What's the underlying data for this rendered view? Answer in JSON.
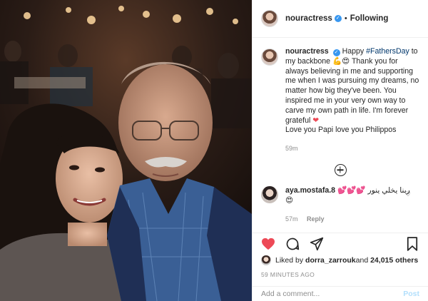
{
  "post": {
    "username": "nouractress",
    "dot": "•",
    "follow_label": "Following",
    "caption": {
      "username": "nouractress",
      "before_tag": "Happy ",
      "hashtag": "#FathersDay",
      "text_1": " to my backbone 💪😍 Thank you for always believing in me and supporting me when I was pursuing my dreams, no matter how big they've been. You inspired me in your very own way to carve my own path in life. I'm forever grateful ",
      "heart": "❤",
      "text_2": "Love you Papi love you Philippos",
      "time": "59m"
    },
    "comment": {
      "username": "aya.mostafa.8",
      "text": "ربنا يخلي ينور 💕💕💕 😍",
      "time": "57m",
      "reply_label": "Reply",
      "like_icon": "heart-outline-icon"
    },
    "likes": {
      "prefix": "Liked by ",
      "user": "dorra_zarrouk",
      "middle": " and ",
      "count": "24,015 others"
    },
    "timestamp": "59 MINUTES AGO",
    "add_comment_placeholder": "Add a comment...",
    "post_label": "Post"
  },
  "colors": {
    "heart": "#ed4956",
    "link": "#00376b",
    "verified": "#3897f0",
    "post_disabled": "#b2dffc",
    "muted": "#8e8e8e"
  }
}
